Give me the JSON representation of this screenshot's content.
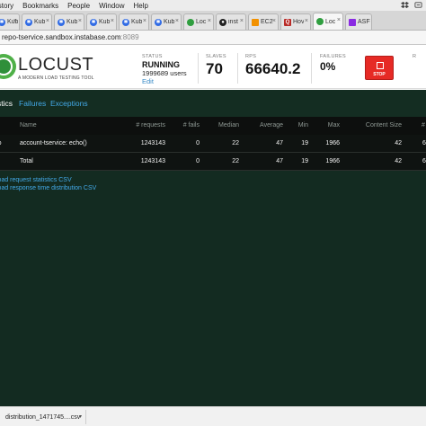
{
  "menubar": {
    "items": [
      "istory",
      "Bookmarks",
      "People",
      "Window",
      "Help"
    ]
  },
  "tabs": [
    {
      "label": "Kub",
      "icon": "kubernetes-icon",
      "color": "#326ce5"
    },
    {
      "label": "Kub",
      "icon": "kubernetes-icon",
      "color": "#326ce5"
    },
    {
      "label": "Kub",
      "icon": "kubernetes-icon",
      "color": "#326ce5"
    },
    {
      "label": "Kub",
      "icon": "kubernetes-icon",
      "color": "#326ce5"
    },
    {
      "label": "Kub",
      "icon": "kubernetes-icon",
      "color": "#326ce5"
    },
    {
      "label": "Kub",
      "icon": "kubernetes-icon",
      "color": "#326ce5"
    },
    {
      "label": "Loc",
      "icon": "locust-icon",
      "color": "#2f9e3f"
    },
    {
      "label": "inst",
      "icon": "github-icon",
      "color": "#222222"
    },
    {
      "label": "EC2",
      "icon": "aws-icon",
      "color": "#f29100"
    },
    {
      "label": "Hov",
      "icon": "quora-icon",
      "color": "#b92b27"
    },
    {
      "label": "Loc",
      "icon": "locust-icon",
      "color": "#2f9e3f",
      "active": true
    },
    {
      "label": "ASF",
      "icon": "asf-icon",
      "color": "#8a2be2"
    }
  ],
  "address": {
    "host": "repo-tservice.sandbox.instabase.com",
    "port": ":8089"
  },
  "header": {
    "brand": "LOCUST",
    "tagline": "A MODERN LOAD TESTING TOOL",
    "status_label": "STATUS",
    "status_value": "RUNNING",
    "users": "1999689 users",
    "edit": "Edit",
    "slaves_label": "SLAVES",
    "slaves_value": "70",
    "rps_label": "RPS",
    "rps_value": "66640.2",
    "failures_label": "FAILURES",
    "failures_value": "0%",
    "stop_label": "STOP",
    "right_stub": "R"
  },
  "subnav": {
    "stats": "stics",
    "failures": "Failures",
    "exceptions": "Exceptions"
  },
  "table": {
    "headers": {
      "type": "",
      "name": "Name",
      "requests": "# requests",
      "fails": "# fails",
      "median": "Median",
      "average": "Average",
      "min": "Min",
      "max": "Max",
      "content_size": "Content Size",
      "rps": "#"
    },
    "rows": [
      {
        "type": "ɔ",
        "name": "account-tservice: echo()",
        "requests": "1243143",
        "fails": "0",
        "median": "22",
        "average": "47",
        "min": "19",
        "max": "1966",
        "content_size": "42",
        "rps": "6"
      },
      {
        "type": "",
        "name": "Total",
        "requests": "1243143",
        "fails": "0",
        "median": "22",
        "average": "47",
        "min": "19",
        "max": "1966",
        "content_size": "42",
        "rps": "6"
      }
    ]
  },
  "links": {
    "request_csv": "load request statistics CSV",
    "distribution_csv": "load response time distribution CSV"
  },
  "download": {
    "filename": "distribution_1471745....csv"
  }
}
